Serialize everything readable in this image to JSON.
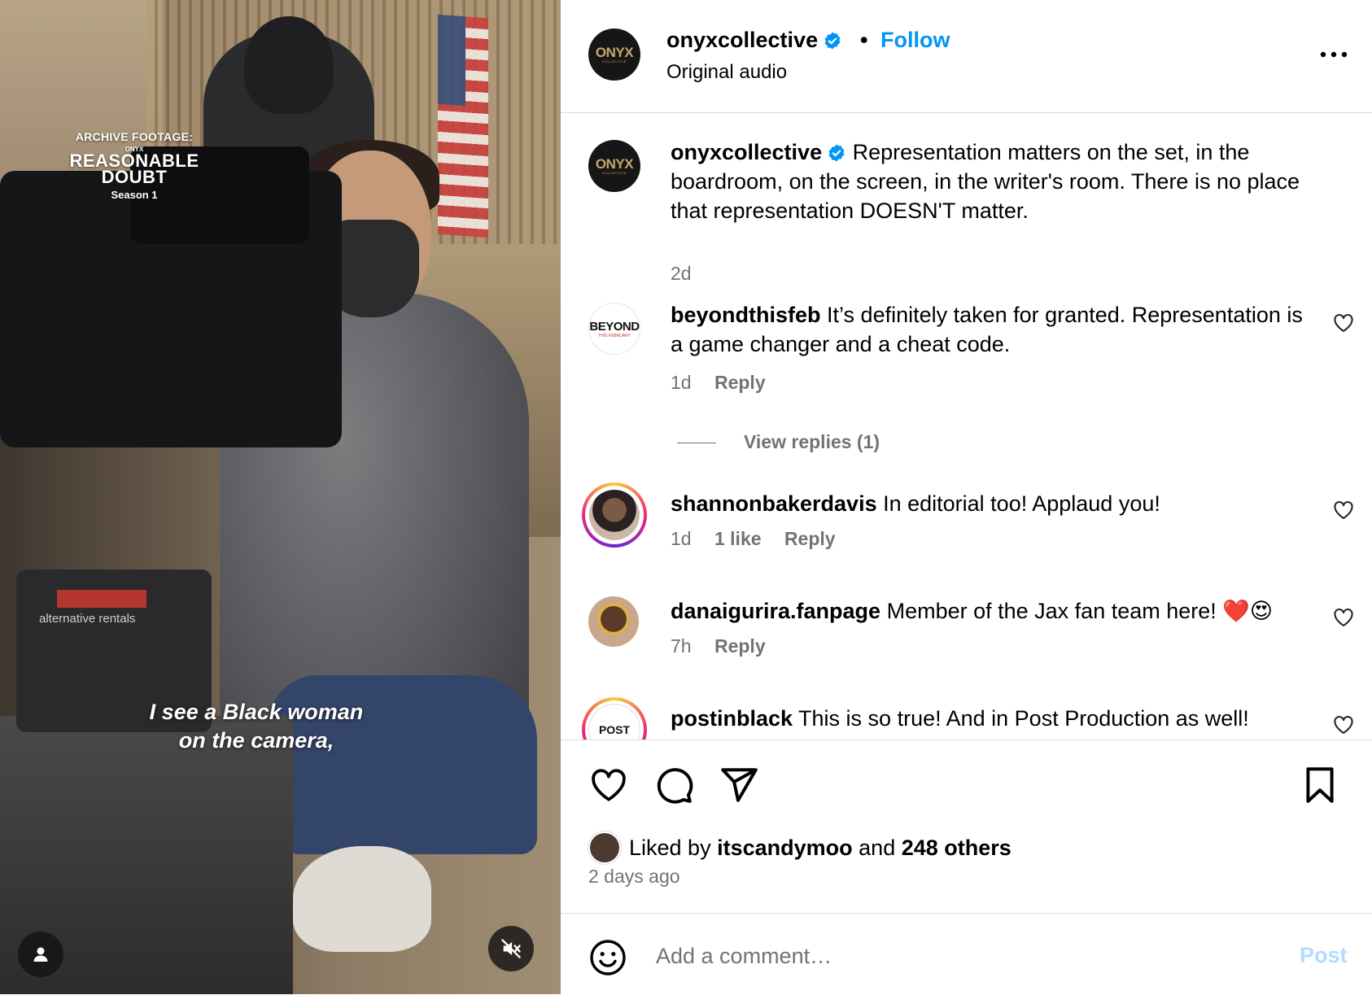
{
  "video": {
    "overlay": {
      "label": "ARCHIVE FOOTAGE:",
      "brand": "ONYX",
      "show_line1": "REASONABLE",
      "show_line2": "DOUBT",
      "season": "Season 1"
    },
    "rental_label": "alternative rentals",
    "caption_line1": "I see a Black woman",
    "caption_line2": "on the camera,",
    "tag_icon": "person-icon",
    "mute_icon": "speaker-muted-icon"
  },
  "header": {
    "username": "onyxcollective",
    "separator": "•",
    "follow_label": "Follow",
    "audio": "Original audio",
    "avatar_text": "ONYX",
    "avatar_sub": "COLLECTIVE"
  },
  "caption": {
    "username": "onyxcollective",
    "text": "Representation matters on the set, in the boardroom, on the screen, in the writer's room. There is no place that representation DOESN'T matter.",
    "time": "2d"
  },
  "comments": [
    {
      "username": "beyondthisfeb",
      "text": "It’s definitely taken for granted. Representation is a game changer and a cheat code.",
      "time": "1d",
      "likes": "",
      "reply_label": "Reply",
      "view_replies": "View replies (1)",
      "avatar_text": "BEYOND",
      "avatar_sub": "THIS FEBRUARY"
    },
    {
      "username": "shannonbakerdavis",
      "text": "In editorial too! Applaud you!",
      "time": "1d",
      "likes": "1 like",
      "reply_label": "Reply"
    },
    {
      "username": "danaigurira.fanpage",
      "text": "Member of the Jax fan team here! ❤️😍",
      "time": "7h",
      "likes": "",
      "reply_label": "Reply"
    },
    {
      "username": "postinblack",
      "text": "This is so true! And in Post Production as well!",
      "avatar_text": "POST"
    }
  ],
  "actions": {
    "liked_prefix": "Liked by",
    "liked_user": "itscandymoo",
    "liked_and": "and",
    "liked_others": "248 others",
    "time_ago": "2 days ago"
  },
  "composer": {
    "placeholder": "Add a comment…",
    "post_label": "Post"
  },
  "colors": {
    "accent": "#0095f6",
    "verified": "#0095f6",
    "muted_text": "#737373",
    "post_disabled": "#b3dbff"
  }
}
